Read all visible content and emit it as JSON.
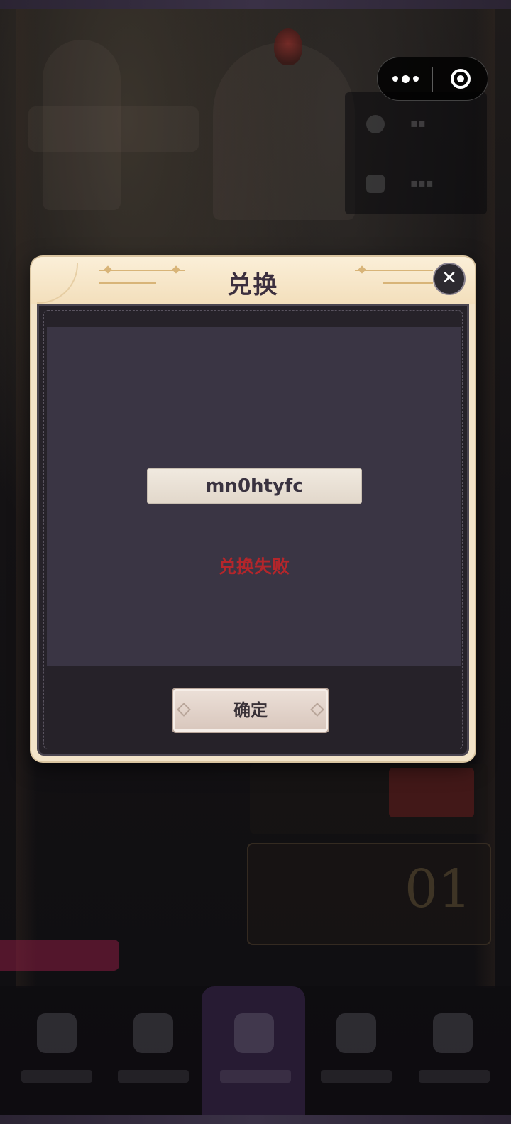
{
  "dialog": {
    "title": "兑换",
    "close_icon": "close-icon",
    "code_value": "mn0htyfc",
    "status_text": "兑换失败",
    "confirm_label": "确定"
  },
  "capsule": {
    "more_icon": "more-dots-icon",
    "close_icon": "target-close-icon"
  },
  "colors": {
    "dialog_header": "#f3dfbc",
    "dialog_body": "#262229",
    "panel": "#3a3544",
    "error_text": "#b4262b",
    "title_text": "#3c2f3e"
  }
}
